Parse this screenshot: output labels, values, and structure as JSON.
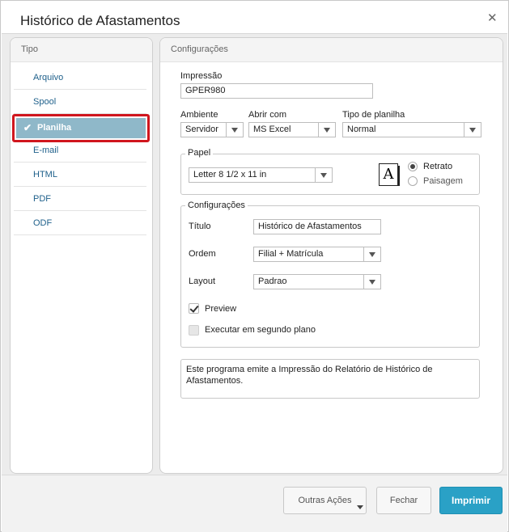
{
  "window": {
    "title": "Histórico de Afastamentos"
  },
  "icons": {
    "close": "close-icon",
    "check": "check-icon",
    "dropdown": "chevron-down-icon",
    "portrait": "portrait-page-icon"
  },
  "tipo": {
    "header": "Tipo",
    "items": [
      "Arquivo",
      "Spool",
      "Planilha",
      "E-mail",
      "HTML",
      "PDF",
      "ODF"
    ],
    "selected": "Planilha"
  },
  "config": {
    "header": "Configurações",
    "impressao": {
      "label": "Impressão",
      "value": "GPER980"
    },
    "ambiente": {
      "label": "Ambiente",
      "value": "Servidor"
    },
    "abrir_com": {
      "label": "Abrir com",
      "value": "MS Excel"
    },
    "tipo_planilha": {
      "label": "Tipo de planilha",
      "value": "Normal"
    },
    "papel": {
      "legend": "Papel",
      "size": "Letter 8 1/2 x 11 in",
      "orientation_options": [
        "Retrato",
        "Paisagem"
      ],
      "orientation_selected": "Retrato"
    },
    "group": {
      "legend": "Configurações",
      "titulo": {
        "label": "Título",
        "value": "Histórico de Afastamentos"
      },
      "ordem": {
        "label": "Ordem",
        "value": "Filial + Matrícula"
      },
      "layout": {
        "label": "Layout",
        "value": "Padrao"
      },
      "preview": {
        "label": "Preview",
        "checked": true
      },
      "segundo_plano": {
        "label": "Executar em segundo plano",
        "checked": false
      }
    },
    "description": "Este programa emite a Impressão do Relatório de Histórico de Afastamentos."
  },
  "footer": {
    "outras_acoes": "Outras Ações",
    "fechar": "Fechar",
    "imprimir": "Imprimir"
  },
  "colors": {
    "accent": "#2aa1c6",
    "selection": "#8fb8c9",
    "highlight_border": "#d0161e"
  }
}
